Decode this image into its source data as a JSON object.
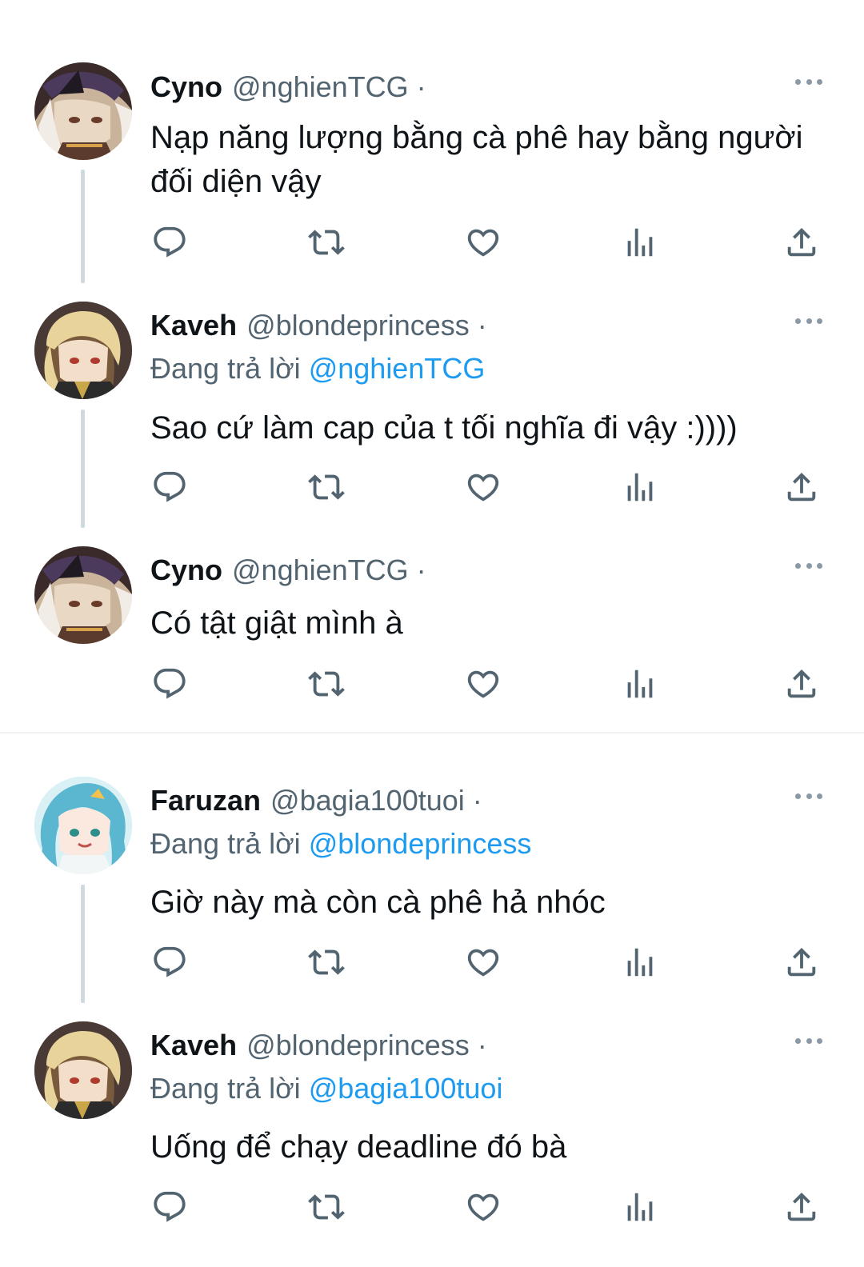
{
  "tweets": [
    {
      "name": "Cyno",
      "handle": "@nghienTCG",
      "dot": "·",
      "reply_prefix": "",
      "reply_to": "",
      "text": "Nạp năng lượng bằng cà phê hay bằng người đối diện vậy",
      "avatar": "cyno-avatar"
    },
    {
      "name": "Kaveh",
      "handle": "@blondeprincess",
      "dot": "·",
      "reply_prefix": "Đang trả lời",
      "reply_to": "@nghienTCG",
      "text": "Sao cứ làm cap của t tối nghĩa đi vậy :))))",
      "avatar": "kaveh-avatar"
    },
    {
      "name": "Cyno",
      "handle": "@nghienTCG",
      "dot": "·",
      "reply_prefix": "",
      "reply_to": "",
      "text": "Có tật giật mình à",
      "avatar": "cyno-avatar"
    },
    {
      "name": "Faruzan",
      "handle": "@bagia100tuoi",
      "dot": "·",
      "reply_prefix": "Đang trả lời",
      "reply_to": "@blondeprincess",
      "text": "Giờ này mà còn cà phê hả nhóc",
      "avatar": "faruzan-avatar"
    },
    {
      "name": "Kaveh",
      "handle": "@blondeprincess",
      "dot": "·",
      "reply_prefix": "Đang trả lời",
      "reply_to": "@bagia100tuoi",
      "text": "Uống để chạy deadline đó bà",
      "avatar": "kaveh-avatar"
    }
  ],
  "actions": [
    "reply-icon",
    "retweet-icon",
    "like-icon",
    "views-icon",
    "share-icon"
  ],
  "colors": {
    "text": "#0f1419",
    "secondary": "#536471",
    "mention": "#1d9bf0",
    "thread_line": "#cfd9de",
    "icon": "#536471"
  }
}
